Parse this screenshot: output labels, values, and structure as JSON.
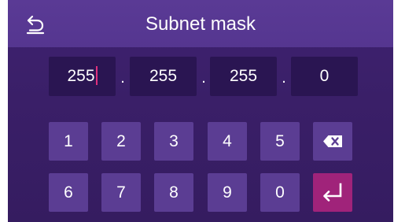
{
  "header": {
    "title": "Subnet mask",
    "back_icon": "back-arrow-icon"
  },
  "ip_fields": [
    {
      "value": "255",
      "focused": true
    },
    {
      "value": "255",
      "focused": false
    },
    {
      "value": "255",
      "focused": false
    },
    {
      "value": "0",
      "focused": false
    }
  ],
  "separator": ".",
  "keypad": {
    "row1": [
      "1",
      "2",
      "3",
      "4",
      "5"
    ],
    "row2": [
      "6",
      "7",
      "8",
      "9",
      "0"
    ],
    "backspace_icon": "backspace-icon",
    "enter_icon": "enter-icon"
  },
  "colors": {
    "background": "#3a1f68",
    "header": "#573892",
    "field": "#2a1552",
    "key": "#5b3d93",
    "enter_key": "#a0237a",
    "caret": "#e0307c"
  }
}
